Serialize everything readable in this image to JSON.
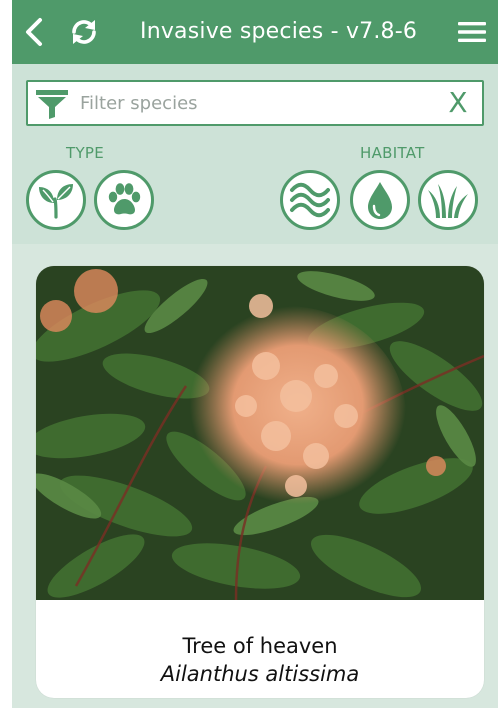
{
  "header": {
    "title": "Invasive species - v7.8-6",
    "color": "#4f9a6a"
  },
  "filter": {
    "placeholder": "Filter species",
    "value": "",
    "clear_label": "X"
  },
  "groups": {
    "type_label": "TYPE",
    "habitat_label": "HABITAT",
    "type_icons": [
      "plant-icon",
      "paw-icon"
    ],
    "habitat_icons": [
      "water-waves-icon",
      "water-drop-icon",
      "grass-icon"
    ]
  },
  "species_card": {
    "common_name": "Tree of heaven",
    "scientific_name": "Ailanthus altissima"
  },
  "colors": {
    "panel_bg": "#cde2d7",
    "content_bg": "#d7e7de",
    "accent": "#4f9a6a"
  }
}
